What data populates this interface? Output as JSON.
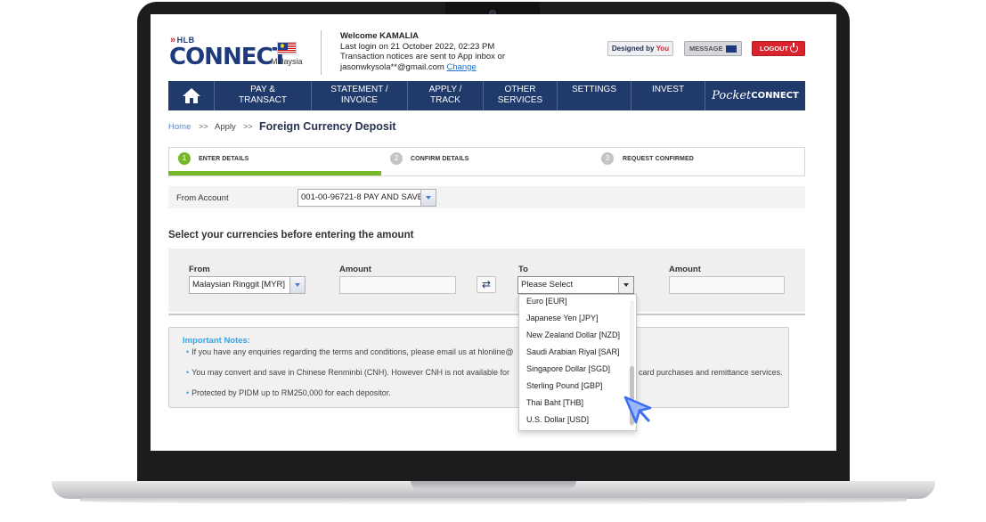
{
  "brand": {
    "hlb": "HLB",
    "connect": "CONNECT",
    "country": "Malaysia"
  },
  "welcome": {
    "greeting": "Welcome KAMALIA",
    "last_login": "Last login on 21 October 2022, 02:23 PM",
    "notice": "Transaction notices are sent to App inbox or",
    "email": "jasonwkysola**@gmail.com",
    "change_link": "Change"
  },
  "header_buttons": {
    "designed_prefix": "Designed by",
    "designed_you": "You",
    "message": "MESSAGE",
    "logout": "LOGOUT"
  },
  "nav": {
    "items": [
      {
        "line1": "PAY &",
        "line2": "TRANSACT"
      },
      {
        "line1": "STATEMENT /",
        "line2": "INVOICE"
      },
      {
        "line1": "APPLY /",
        "line2": "TRACK"
      },
      {
        "line1": "OTHER",
        "line2": "SERVICES"
      },
      {
        "line1": "SETTINGS",
        "line2": ""
      },
      {
        "line1": "INVEST",
        "line2": ""
      }
    ],
    "pocket_italic": "Pocket",
    "pocket_bold": "CONNECT"
  },
  "breadcrumb": {
    "home": "Home",
    "sep": ">>",
    "apply": "Apply",
    "current": "Foreign Currency Deposit"
  },
  "steps": [
    {
      "num": "1",
      "label": "ENTER DETAILS",
      "color": "#76b82a"
    },
    {
      "num": "2",
      "label": "CONFIRM DETAILS",
      "color": "#c4c4c4"
    },
    {
      "num": "3",
      "label": "REQUEST CONFIRMED",
      "color": "#c4c4c4"
    }
  ],
  "progress": 0.333,
  "account": {
    "label": "From Account",
    "value": "001-00-96721-8 PAY AND SAVE"
  },
  "section_title": "Select your currencies before entering the amount",
  "currency": {
    "from_label": "From",
    "from_value": "Malaysian Ringgit [MYR]",
    "amount_label": "Amount",
    "to_label": "To",
    "to_value": "Please Select",
    "amount2_label": "Amount",
    "swap_glyph": "⇄"
  },
  "dropdown_options": [
    "Euro [EUR]",
    "Japanese Yen [JPY]",
    "New Zealand Dollar [NZD]",
    "Saudi Arabian Riyal [SAR]",
    "Singapore Dollar [SGD]",
    "Sterling Pound [GBP]",
    "Thai Baht [THB]",
    "U.S. Dollar [USD]"
  ],
  "notes": {
    "title": "Important Notes:",
    "bullet": "•",
    "items": [
      "If you have any enquiries regarding the terms and conditions, please email us at hlonline@",
      "You may convert and save in Chinese Renminbi (CNH). However CNH is not available for",
      "Protected by PIDM up to RM250,000 for each depositor."
    ],
    "tail": "card purchases and remittance services."
  },
  "colors": {
    "brand_navy": "#1f3a6b",
    "accent_red": "#d9232d",
    "step_green": "#76b82a",
    "link_blue": "#3ba3e0"
  }
}
